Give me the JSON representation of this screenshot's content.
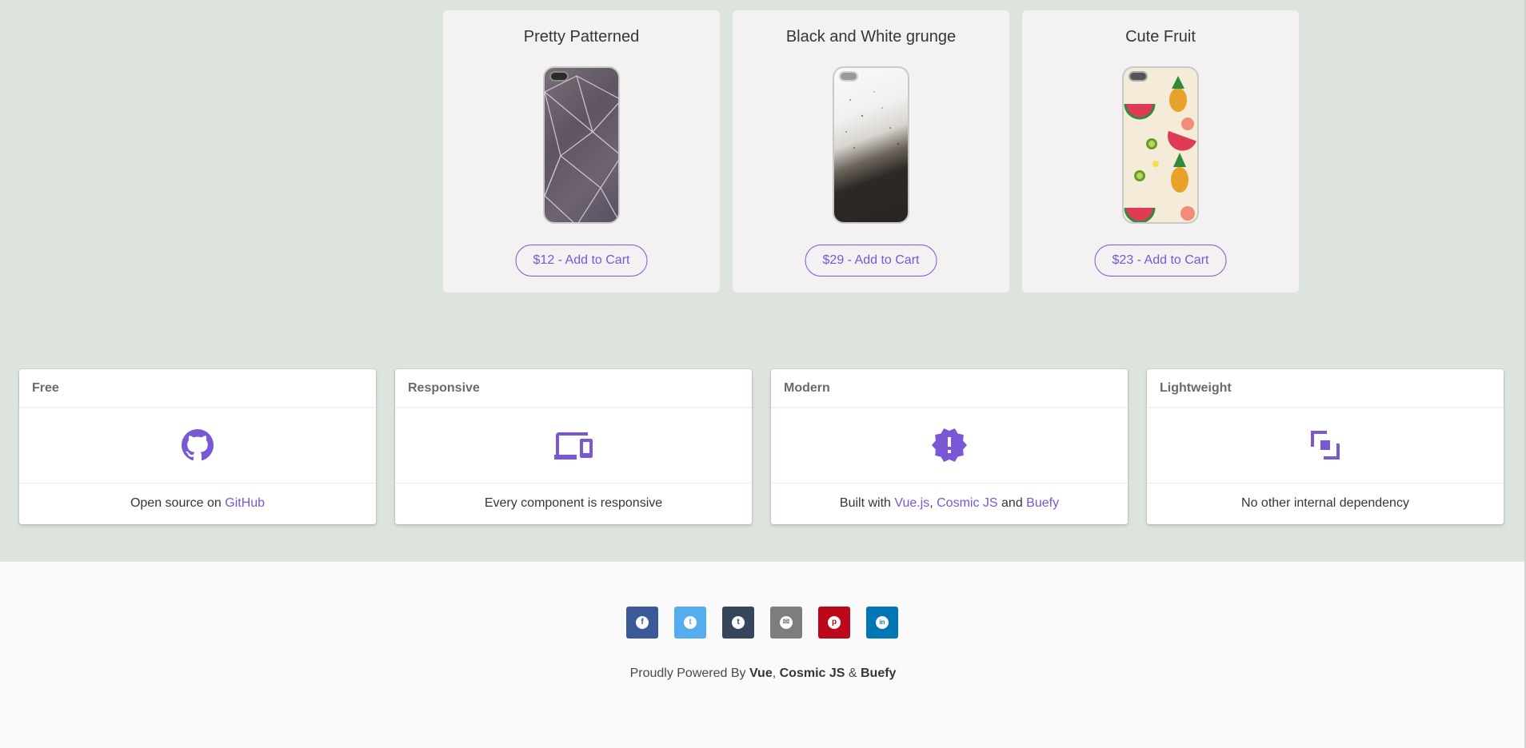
{
  "products": [
    {
      "title": "Pretty Patterned",
      "button": "$12 - Add to Cart"
    },
    {
      "title": "Black and White grunge",
      "button": "$29 - Add to Cart"
    },
    {
      "title": "Cute Fruit",
      "button": "$23 - Add to Cart"
    }
  ],
  "features": [
    {
      "header": "Free",
      "icon": "github-icon",
      "text_prefix": "Open source on ",
      "link1": "GitHub"
    },
    {
      "header": "Responsive",
      "icon": "devices-icon",
      "text": "Every component is responsive"
    },
    {
      "header": "Modern",
      "icon": "alert-decagram-icon",
      "text_prefix": "Built with ",
      "link1": "Vue.js",
      "sep1": ", ",
      "link2": "Cosmic JS",
      "sep2": " and ",
      "link3": "Buefy"
    },
    {
      "header": "Lightweight",
      "icon": "arrange-icon",
      "text": "No other internal dependency"
    }
  ],
  "footer": {
    "share": [
      {
        "name": "facebook-icon",
        "glyph": "f",
        "color": "#3b5998"
      },
      {
        "name": "twitter-icon",
        "glyph": "t",
        "color": "#55acee"
      },
      {
        "name": "tumblr-icon",
        "glyph": "t",
        "color": "#35465c"
      },
      {
        "name": "email-icon",
        "glyph": "✉",
        "color": "#7d7d7d"
      },
      {
        "name": "pinterest-icon",
        "glyph": "p",
        "color": "#bd081c"
      },
      {
        "name": "linkedin-icon",
        "glyph": "in",
        "color": "#0077b5"
      }
    ],
    "powered_prefix": "Proudly Powered By ",
    "vue": "Vue",
    "comma": ", ",
    "cosmic": "Cosmic JS",
    "amp": " & ",
    "buefy": "Buefy"
  },
  "colors": {
    "accent": "#7957d5",
    "background": "#dde3dd",
    "card": "#f3f1f2",
    "footer": "#fafafa"
  }
}
